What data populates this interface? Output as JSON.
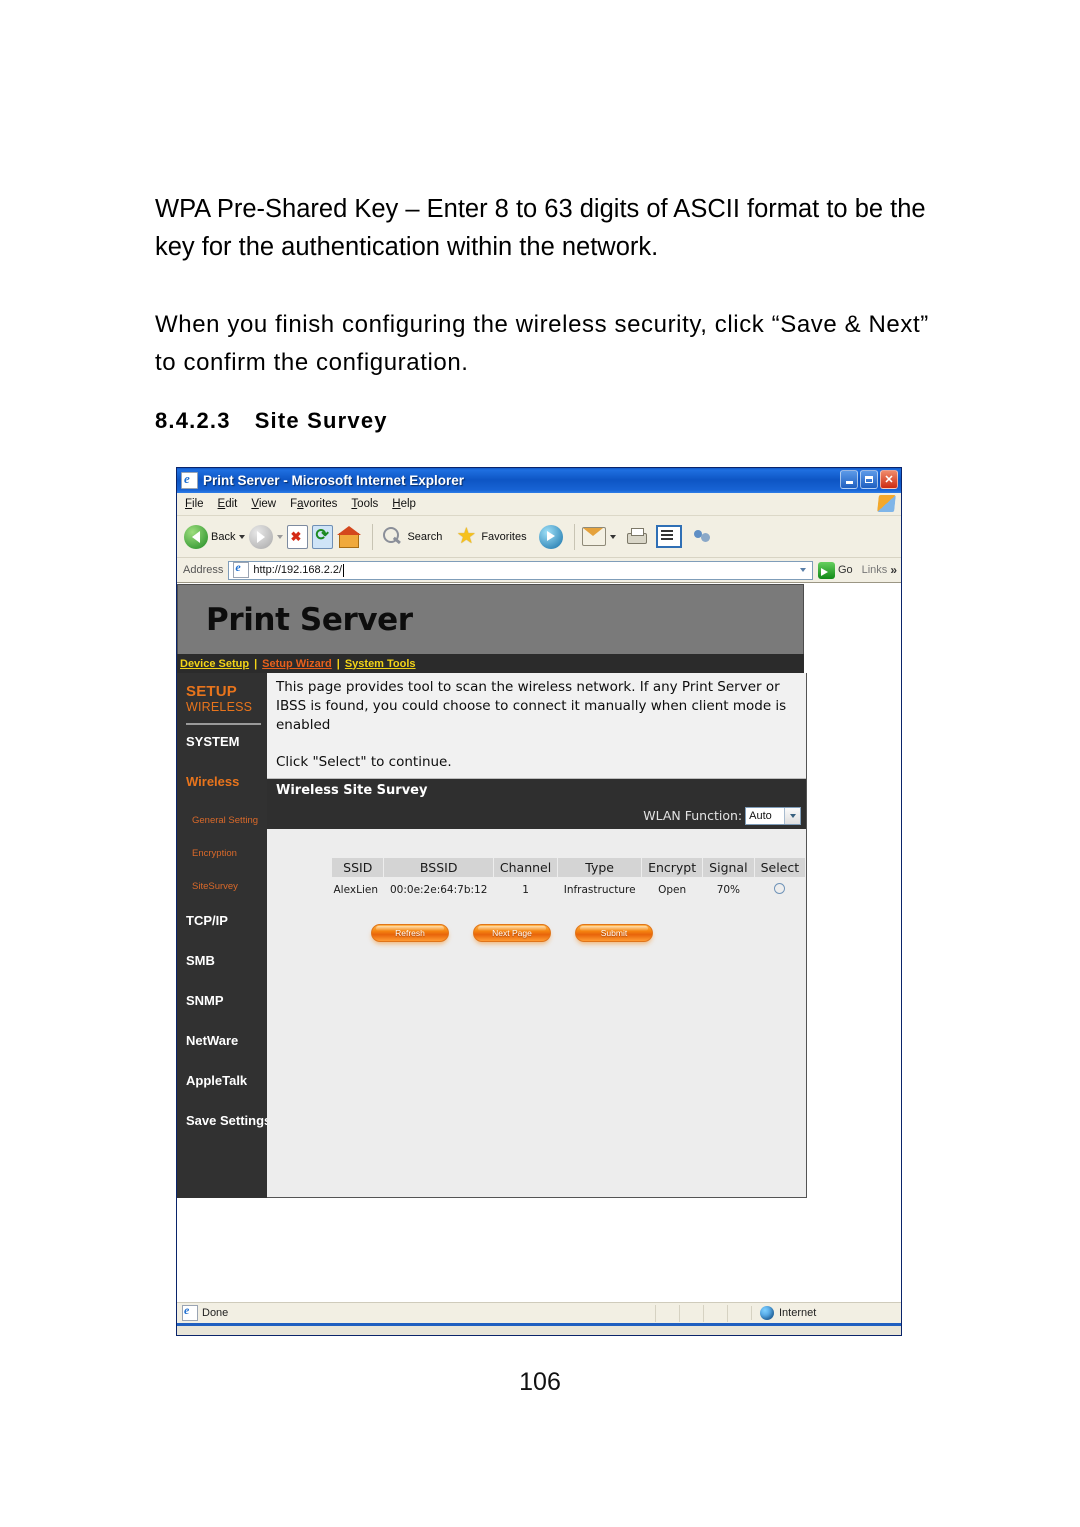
{
  "document": {
    "paragraph1": "WPA Pre-Shared Key – Enter 8 to 63 digits of ASCII format to be the key for the authentication within the network.",
    "paragraph2": "When you finish configuring the wireless security, click “Save & Next” to confirm the configuration.",
    "heading_number": "8.4.2.3",
    "heading_text": "Site Survey",
    "page_number": "106"
  },
  "browser": {
    "window_title": "Print Server - Microsoft Internet Explorer",
    "menu": [
      "File",
      "Edit",
      "View",
      "Favorites",
      "Tools",
      "Help"
    ],
    "toolbar": {
      "back_label": "Back",
      "search_label": "Search",
      "favorites_label": "Favorites"
    },
    "address": {
      "label": "Address",
      "url": "http://192.168.2.2/",
      "go_label": "Go",
      "links_label": "Links"
    },
    "status": {
      "text": "Done",
      "zone": "Internet"
    }
  },
  "app": {
    "title": "Print Server",
    "topnav": [
      {
        "label": "Device Setup",
        "color": "#f3d417"
      },
      {
        "label": "Setup Wizard",
        "color": "#e8601c"
      },
      {
        "label": "System Tools",
        "color": "#f3d417"
      }
    ],
    "sidebar": {
      "setup_line1": "SETUP",
      "setup_line2": "WIRELESS",
      "items": [
        {
          "label": "SYSTEM",
          "active": false
        },
        {
          "label": "Wireless",
          "active": true
        },
        {
          "label": "TCP/IP",
          "active": false
        },
        {
          "label": "SMB",
          "active": false
        },
        {
          "label": "SNMP",
          "active": false
        },
        {
          "label": "NetWare",
          "active": false
        },
        {
          "label": "AppleTalk",
          "active": false
        },
        {
          "label": "Save Settings",
          "active": false
        }
      ],
      "sub_items": [
        {
          "label": "General Setting"
        },
        {
          "label": "Encryption"
        },
        {
          "label": "SiteSurvey"
        }
      ]
    },
    "intro": {
      "line1": "This page provides tool to scan the wireless network. If any Print Server or IBSS is found, you could choose to connect it manually when client mode is enabled",
      "line2": "Click \"Select\" to continue."
    },
    "section_title": "Wireless Site Survey",
    "wlan_function": {
      "label": "WLAN Function:",
      "value": "Auto"
    },
    "table": {
      "headers": [
        "SSID",
        "BSSID",
        "Channel",
        "Type",
        "Encrypt",
        "Signal",
        "Select"
      ],
      "rows": [
        {
          "ssid": "AlexLien",
          "bssid": "00:0e:2e:64:7b:12",
          "channel": "1",
          "type": "Infrastructure",
          "encrypt": "Open",
          "signal": "70%",
          "select": ""
        }
      ]
    },
    "buttons": [
      {
        "label": "Refresh"
      },
      {
        "label": "Next Page"
      },
      {
        "label": "Submit"
      }
    ],
    "colors": {
      "accent_orange": "#e8741c",
      "nav_yellow": "#f3d417",
      "header_gray": "#7a7a7a",
      "sidebar_dark": "#313131"
    }
  }
}
